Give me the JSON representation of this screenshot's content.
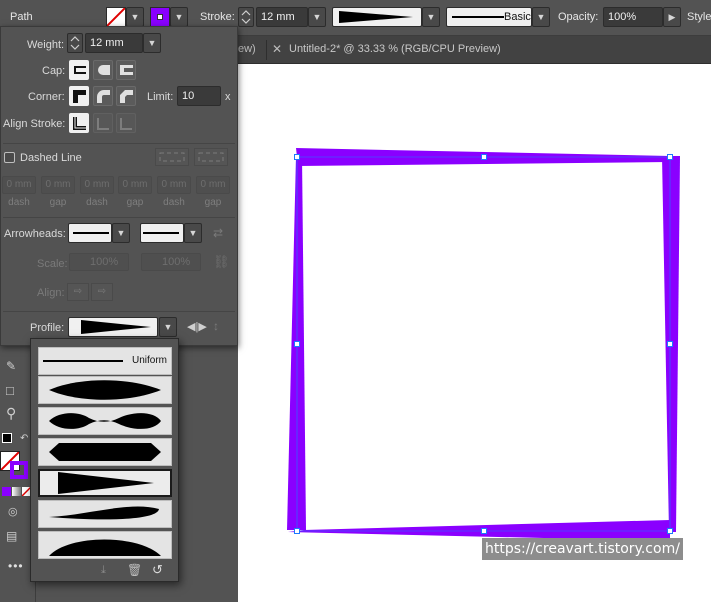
{
  "control_bar": {
    "selection_type": "Path",
    "stroke_label": "Stroke:",
    "stroke_weight": "12 mm",
    "brush_style": "Basic",
    "opacity_label": "Opacity:",
    "opacity_value": "100%",
    "style_label": "Style:",
    "stroke_color": "#8a00ff"
  },
  "document_tabs": [
    {
      "label": "ew)"
    },
    {
      "label": "Untitled-2* @ 33.33 % (RGB/CPU Preview)"
    }
  ],
  "stroke_panel": {
    "weight_label": "Weight:",
    "weight_value": "12 mm",
    "cap_label": "Cap:",
    "corner_label": "Corner:",
    "limit_label": "Limit:",
    "limit_value": "10",
    "limit_unit": "x",
    "align_label": "Align Stroke:",
    "dashed_label": "Dashed Line",
    "dashed_checked": false,
    "dash_fields": [
      {
        "value": "0 mm",
        "label": "dash"
      },
      {
        "value": "0 mm",
        "label": "gap"
      },
      {
        "value": "0 mm",
        "label": "dash"
      },
      {
        "value": "0 mm",
        "label": "gap"
      },
      {
        "value": "0 mm",
        "label": "dash"
      },
      {
        "value": "0 mm",
        "label": "gap"
      }
    ],
    "arrowheads_label": "Arrowheads:",
    "scale_label": "Scale:",
    "scale_start": "100%",
    "scale_end": "100%",
    "align_arrow_label": "Align:",
    "profile_label": "Profile:"
  },
  "profile_menu": {
    "items": [
      {
        "name": "uniform",
        "label": "Uniform"
      },
      {
        "name": "width-profile-1",
        "label": ""
      },
      {
        "name": "width-profile-2",
        "label": ""
      },
      {
        "name": "width-profile-3",
        "label": ""
      },
      {
        "name": "width-profile-4",
        "label": ""
      },
      {
        "name": "width-profile-5",
        "label": ""
      },
      {
        "name": "width-profile-6",
        "label": ""
      }
    ],
    "selected_index": 4
  },
  "watermark": "https://creavart.tistory.com/",
  "colors": {
    "panel_bg": "#535353",
    "accent_purple": "#8a00ff",
    "selection_blue": "#1e78ff"
  }
}
